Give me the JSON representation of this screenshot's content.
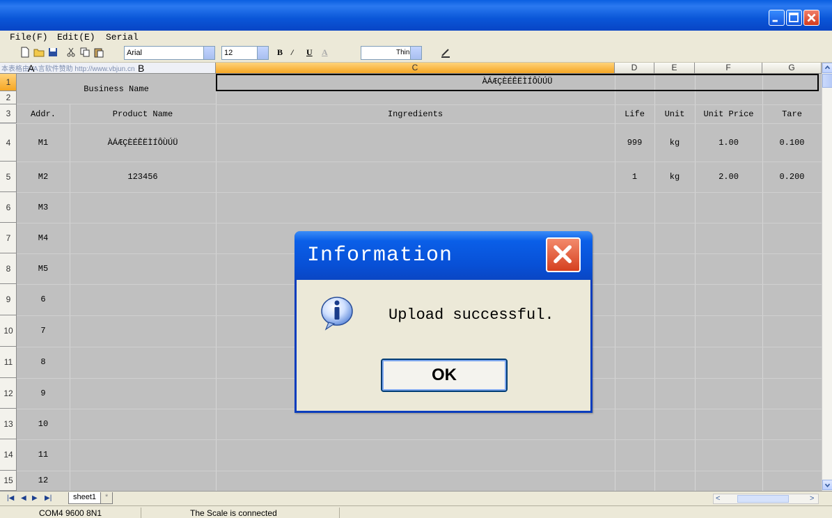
{
  "window": {
    "title": "",
    "buttons": [
      "minimize",
      "maximize",
      "close"
    ]
  },
  "menu": {
    "items": [
      "File(F)",
      "Edit(E)",
      "Serial"
    ]
  },
  "toolbar": {
    "font_name": "Arial",
    "font_size": "12",
    "bold": "B",
    "italic": "/",
    "underline": "U",
    "font_color": "A",
    "line_style": "Thin"
  },
  "grid": {
    "watermark": "本表格由VA言软件赞助 http://www.vbjun.cn",
    "columns": [
      "A",
      "B",
      "C",
      "D",
      "E",
      "F",
      "G"
    ],
    "header_cells": {
      "business_name": "Business Name",
      "merged_title": "ÀÁÆÇÈÉÊËÌÍÔÙÚÜ"
    },
    "col_titles": [
      "Addr.",
      "Product Name",
      "Ingredients",
      "Life",
      "Unit",
      "Unit Price",
      "Tare"
    ],
    "row_numbers": [
      "1",
      "2",
      "3",
      "4",
      "5",
      "6",
      "7",
      "8",
      "9",
      "10",
      "11",
      "12",
      "13",
      "14",
      "15"
    ],
    "rows": [
      {
        "addr": "M1",
        "product": "ÀÁÆÇÈÉÊËÌÍÔÙÚÜ",
        "ingredients": "",
        "life": "999",
        "unit": "kg",
        "price": "1.00",
        "tare": "0.100"
      },
      {
        "addr": "M2",
        "product": "123456",
        "ingredients": "",
        "life": "1",
        "unit": "kg",
        "price": "2.00",
        "tare": "0.200"
      },
      {
        "addr": "M3",
        "product": "",
        "ingredients": "",
        "life": "",
        "unit": "",
        "price": "",
        "tare": ""
      },
      {
        "addr": "M4",
        "product": "",
        "ingredients": "",
        "life": "",
        "unit": "",
        "price": "",
        "tare": ""
      },
      {
        "addr": "M5",
        "product": "",
        "ingredients": "",
        "life": "",
        "unit": "",
        "price": "",
        "tare": ""
      },
      {
        "addr": "6",
        "product": "",
        "ingredients": "",
        "life": "",
        "unit": "",
        "price": "",
        "tare": ""
      },
      {
        "addr": "7",
        "product": "",
        "ingredients": "",
        "life": "",
        "unit": "",
        "price": "",
        "tare": ""
      },
      {
        "addr": "8",
        "product": "",
        "ingredients": "",
        "life": "",
        "unit": "",
        "price": "",
        "tare": ""
      },
      {
        "addr": "9",
        "product": "",
        "ingredients": "",
        "life": "",
        "unit": "",
        "price": "",
        "tare": ""
      },
      {
        "addr": "10",
        "product": "",
        "ingredients": "",
        "life": "",
        "unit": "",
        "price": "",
        "tare": ""
      },
      {
        "addr": "11",
        "product": "",
        "ingredients": "",
        "life": "",
        "unit": "",
        "price": "",
        "tare": ""
      },
      {
        "addr": "12",
        "product": "",
        "ingredients": "",
        "life": "",
        "unit": "",
        "price": "",
        "tare": ""
      }
    ]
  },
  "tabs": {
    "sheets": [
      "sheet1",
      "*"
    ]
  },
  "status": {
    "port": "COM4 9600 8N1",
    "connection": "The Scale is connected"
  },
  "dialog": {
    "title": "Information",
    "message": "Upload successful.",
    "ok_label": "OK"
  },
  "colors": {
    "titlebar": "#0a56d8",
    "grid_bg": "#c0c0c0",
    "active_header": "#f5a623",
    "dialog_close": "#d5401f"
  }
}
